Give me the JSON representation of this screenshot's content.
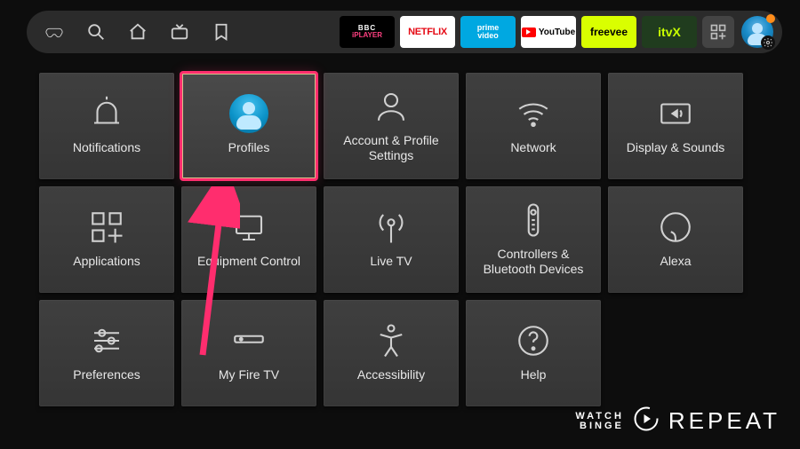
{
  "topbar": {
    "nav": [
      {
        "name": "home-icon"
      },
      {
        "name": "search-icon"
      },
      {
        "name": "house-icon"
      },
      {
        "name": "live-icon"
      },
      {
        "name": "bookmark-icon"
      }
    ],
    "apps": [
      {
        "name": "bbc-iplayer",
        "line1": "BBC",
        "line2": "iPLAYER",
        "bg": "#000"
      },
      {
        "name": "netflix",
        "label": "NETFLIX",
        "bg": "#fff"
      },
      {
        "name": "prime-video",
        "line1": "prime",
        "line2": "video",
        "bg": "#00a8e1"
      },
      {
        "name": "youtube",
        "label": "YouTube",
        "bg": "#fff"
      },
      {
        "name": "freevee",
        "label": "freevee",
        "bg": "#d9ff00"
      },
      {
        "name": "itvx",
        "label": "itvX",
        "bg": "#203c1e"
      }
    ],
    "apps_button": "apps-grid-icon",
    "profile": {
      "has_notification": true,
      "has_settings_gear": true
    }
  },
  "settings": {
    "tiles": [
      {
        "name": "notifications",
        "label": "Notifications",
        "icon": "bell",
        "selected": false
      },
      {
        "name": "profiles",
        "label": "Profiles",
        "icon": "profile",
        "selected": true
      },
      {
        "name": "account",
        "label": "Account & Profile Settings",
        "icon": "person",
        "selected": false
      },
      {
        "name": "network",
        "label": "Network",
        "icon": "wifi",
        "selected": false
      },
      {
        "name": "display",
        "label": "Display & Sounds",
        "icon": "display",
        "selected": false
      },
      {
        "name": "applications",
        "label": "Applications",
        "icon": "apps",
        "selected": false
      },
      {
        "name": "equipment",
        "label": "Equipment Control",
        "icon": "monitor",
        "selected": false
      },
      {
        "name": "livetv",
        "label": "Live TV",
        "icon": "antenna",
        "selected": false
      },
      {
        "name": "controllers",
        "label": "Controllers & Bluetooth Devices",
        "icon": "remote",
        "selected": false
      },
      {
        "name": "alexa",
        "label": "Alexa",
        "icon": "alexa",
        "selected": false
      },
      {
        "name": "preferences",
        "label": "Preferences",
        "icon": "sliders",
        "selected": false
      },
      {
        "name": "myfiretv",
        "label": "My Fire TV",
        "icon": "firetv",
        "selected": false
      },
      {
        "name": "accessibility",
        "label": "Accessibility",
        "icon": "accessibility",
        "selected": false
      },
      {
        "name": "help",
        "label": "Help",
        "icon": "help",
        "selected": false
      }
    ]
  },
  "annotation": {
    "arrow_target": "profiles",
    "color": "#ff2d6e"
  },
  "watermark": {
    "line1": "WATCH",
    "line2": "BINGE",
    "word": "REPEAT"
  }
}
